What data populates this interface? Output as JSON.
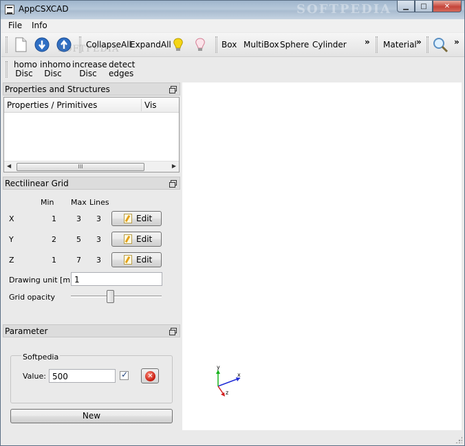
{
  "window": {
    "title": "AppCSXCAD",
    "watermark": "SOFTPEDIA",
    "controls": {
      "minimize": "▁",
      "maximize": "□",
      "close": "✕"
    }
  },
  "menubar": {
    "items": [
      "File",
      "Info"
    ]
  },
  "toolbar": {
    "icons": {
      "new": "new-file-icon",
      "import": "import-icon",
      "export": "export-icon",
      "show": "lightbulb-on-icon",
      "hide": "lightbulb-off-icon",
      "zoom": "magnifier-icon"
    },
    "collapse_all": "CollapseAll",
    "expand_all": "ExpandAll",
    "box": "Box",
    "multibox": "MultiBox",
    "sphere": "Sphere",
    "cylinder": "Cylinder",
    "material": "Material",
    "overflow": "»",
    "watermark": "SOFTPEDIA"
  },
  "toolbar2": [
    {
      "line1": "homo",
      "line2": "Disc"
    },
    {
      "line1": "inhomo",
      "line2": "Disc"
    },
    {
      "line1": "increase",
      "line2": "Disc"
    },
    {
      "line1": "detect",
      "line2": "edges"
    }
  ],
  "properties_dock": {
    "title": "Properties and Structures",
    "columns": [
      "Properties / Primitives",
      "Vis"
    ],
    "scrollbar_grip": "III",
    "scroll_left": "◀",
    "scroll_right": "▶"
  },
  "grid_dock": {
    "title": "Rectilinear Grid",
    "headers": {
      "min": "Min",
      "max": "Max",
      "lines": "Lines"
    },
    "rows": [
      {
        "axis": "X",
        "min": "1",
        "max": "3",
        "lines": "3",
        "edit": "Edit"
      },
      {
        "axis": "Y",
        "min": "2",
        "max": "5",
        "lines": "3",
        "edit": "Edit"
      },
      {
        "axis": "Z",
        "min": "1",
        "max": "7",
        "lines": "3",
        "edit": "Edit"
      }
    ],
    "drawing_unit_label": "Drawing unit [m]:",
    "drawing_unit_value": "1",
    "grid_opacity_label": "Grid opacity",
    "grid_opacity_level": 0.43
  },
  "parameter_dock": {
    "title": "Parameter",
    "group_title": "Softpedia",
    "value_label": "Value:",
    "value": "500",
    "checked": true,
    "new_button": "New"
  },
  "viewport": {
    "axis_labels": {
      "x": "x",
      "y": "y",
      "z": "z"
    },
    "colors": {
      "x": "#1f2bd6",
      "y": "#17b21c",
      "z": "#d21f1f"
    }
  }
}
